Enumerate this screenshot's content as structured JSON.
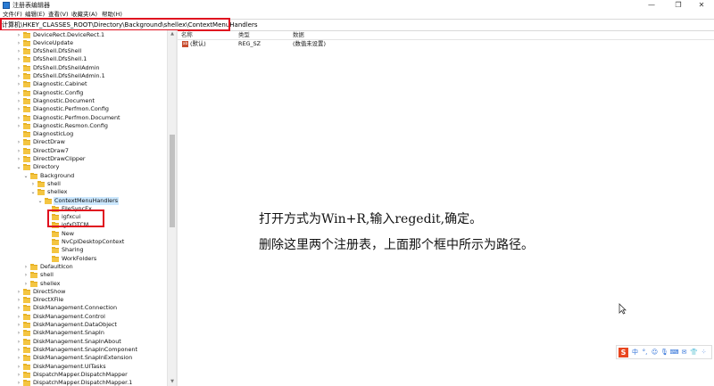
{
  "window": {
    "title": "注册表编辑器",
    "minimize_glyph": "—",
    "maximize_glyph": "❐",
    "close_glyph": "✕"
  },
  "menu": [
    "文件(F)",
    "编辑(E)",
    "查看(V)",
    "收藏夹(A)",
    "帮助(H)"
  ],
  "address": "计算机\\HKEY_CLASSES_ROOT\\Directory\\Background\\shellex\\ContextMenuHandlers",
  "tree": [
    {
      "label": "DeviceRect.DeviceRect.1",
      "depth": 1,
      "chev": "›"
    },
    {
      "label": "DeviceUpdate",
      "depth": 1,
      "chev": "›"
    },
    {
      "label": "DfsShell.DfsShell",
      "depth": 1,
      "chev": "›"
    },
    {
      "label": "DfsShell.DfsShell.1",
      "depth": 1,
      "chev": "›"
    },
    {
      "label": "DfsShell.DfsShellAdmin",
      "depth": 1,
      "chev": "›"
    },
    {
      "label": "DfsShell.DfsShellAdmin.1",
      "depth": 1,
      "chev": "›"
    },
    {
      "label": "Diagnostic.Cabinet",
      "depth": 1,
      "chev": "›"
    },
    {
      "label": "Diagnostic.Config",
      "depth": 1,
      "chev": "›"
    },
    {
      "label": "Diagnostic.Document",
      "depth": 1,
      "chev": "›"
    },
    {
      "label": "Diagnostic.Perfmon.Config",
      "depth": 1,
      "chev": "›"
    },
    {
      "label": "Diagnostic.Perfmon.Document",
      "depth": 1,
      "chev": "›"
    },
    {
      "label": "Diagnostic.Resmon.Config",
      "depth": 1,
      "chev": "›"
    },
    {
      "label": "DiagnosticLog",
      "depth": 1,
      "chev": ""
    },
    {
      "label": "DirectDraw",
      "depth": 1,
      "chev": "›"
    },
    {
      "label": "DirectDraw7",
      "depth": 1,
      "chev": "›"
    },
    {
      "label": "DirectDrawClipper",
      "depth": 1,
      "chev": "›"
    },
    {
      "label": "Directory",
      "depth": 1,
      "chev": "⌄"
    },
    {
      "label": "Background",
      "depth": 2,
      "chev": "⌄"
    },
    {
      "label": "shell",
      "depth": 3,
      "chev": "›"
    },
    {
      "label": "shellex",
      "depth": 3,
      "chev": "⌄"
    },
    {
      "label": "ContextMenuHandlers",
      "depth": 4,
      "chev": "⌄",
      "selected": true
    },
    {
      "label": "FileSyncEx",
      "depth": 5,
      "chev": ""
    },
    {
      "label": "igfxcui",
      "depth": 5,
      "chev": ""
    },
    {
      "label": "igfxDTCM",
      "depth": 5,
      "chev": ""
    },
    {
      "label": "New",
      "depth": 5,
      "chev": ""
    },
    {
      "label": "NvCplDesktopContext",
      "depth": 5,
      "chev": ""
    },
    {
      "label": "Sharing",
      "depth": 5,
      "chev": ""
    },
    {
      "label": "WorkFolders",
      "depth": 5,
      "chev": ""
    },
    {
      "label": "DefaultIcon",
      "depth": 2,
      "chev": "›"
    },
    {
      "label": "shell",
      "depth": 2,
      "chev": "›"
    },
    {
      "label": "shellex",
      "depth": 2,
      "chev": "›"
    },
    {
      "label": "DirectShow",
      "depth": 1,
      "chev": "›"
    },
    {
      "label": "DirectXFile",
      "depth": 1,
      "chev": "›"
    },
    {
      "label": "DiskManagement.Connection",
      "depth": 1,
      "chev": "›"
    },
    {
      "label": "DiskManagement.Control",
      "depth": 1,
      "chev": "›"
    },
    {
      "label": "DiskManagement.DataObject",
      "depth": 1,
      "chev": "›"
    },
    {
      "label": "DiskManagement.SnapIn",
      "depth": 1,
      "chev": "›"
    },
    {
      "label": "DiskManagement.SnapInAbout",
      "depth": 1,
      "chev": "›"
    },
    {
      "label": "DiskManagement.SnapInComponent",
      "depth": 1,
      "chev": "›"
    },
    {
      "label": "DiskManagement.SnapInExtension",
      "depth": 1,
      "chev": "›"
    },
    {
      "label": "DiskManagement.UITasks",
      "depth": 1,
      "chev": "›"
    },
    {
      "label": "DispatchMapper.DispatchMapper",
      "depth": 1,
      "chev": "›"
    },
    {
      "label": "DispatchMapper.DispatchMapper.1",
      "depth": 1,
      "chev": "›"
    }
  ],
  "list": {
    "columns": [
      "名称",
      "类型",
      "数据"
    ],
    "rows": [
      {
        "name": "(默认)",
        "type": "REG_SZ",
        "data": "(数值未设置)",
        "icon": "ab"
      }
    ]
  },
  "instructions": [
    "打开方式为Win+R,输入regedit,确定。",
    "删除这里两个注册表，上面那个框中所示为路径。"
  ],
  "ime": {
    "logo": "S",
    "items": [
      "中",
      "°,",
      "☺",
      "🎙",
      "⌨",
      "✉",
      "👕",
      "⁘"
    ]
  },
  "colors": {
    "highlight_border": "#e0101f",
    "selection": "#cce8ff",
    "folder": "#f4c542"
  }
}
